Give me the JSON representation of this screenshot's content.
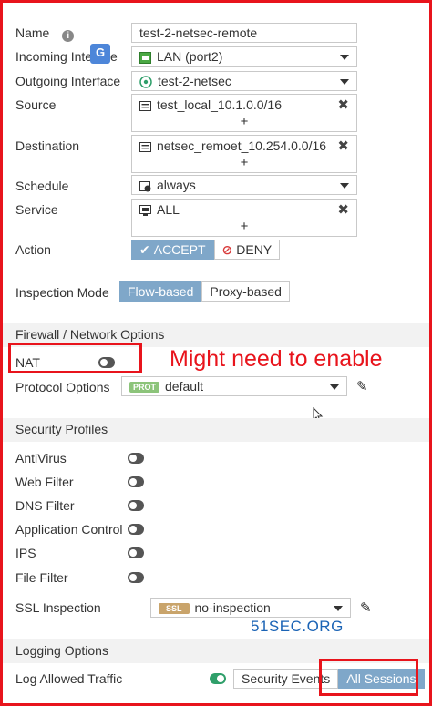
{
  "form": {
    "name_label": "Name",
    "name_value": "test-2-netsec-remote",
    "incoming_label": "Incoming Inte",
    "incoming_label_tail": "e",
    "incoming_value": "LAN (port2)",
    "outgoing_label": "Outgoing Interface",
    "outgoing_value": "test-2-netsec",
    "source_label": "Source",
    "source_value": "test_local_10.1.0.0/16",
    "destination_label": "Destination",
    "destination_value": "netsec_remoet_10.254.0.0/16",
    "schedule_label": "Schedule",
    "schedule_value": "always",
    "service_label": "Service",
    "service_value": "ALL",
    "action_label": "Action",
    "accept_label": "ACCEPT",
    "deny_label": "DENY",
    "plus": "+",
    "remove": "✖",
    "inspection_label": "Inspection Mode",
    "flow_label": "Flow-based",
    "proxy_label": "Proxy-based"
  },
  "firewall": {
    "section_title": "Firewall / Network Options",
    "nat_label": "NAT",
    "nat_enabled": false,
    "protocol_label": "Protocol Options",
    "protocol_tag": "PROT",
    "protocol_value": "default"
  },
  "annotation": {
    "text": "Might need to enable"
  },
  "profiles": {
    "section_title": "Security Profiles",
    "items": [
      {
        "label": "AntiVirus",
        "enabled": false
      },
      {
        "label": "Web Filter",
        "enabled": false
      },
      {
        "label": "DNS Filter",
        "enabled": false
      },
      {
        "label": "Application Control",
        "enabled": false
      },
      {
        "label": "IPS",
        "enabled": false
      },
      {
        "label": "File Filter",
        "enabled": false
      }
    ],
    "ssl_label": "SSL Inspection",
    "ssl_tag": "SSL",
    "ssl_value": "no-inspection"
  },
  "watermark": "51SEC.ORG",
  "logging": {
    "section_title": "Logging Options",
    "log_label": "Log Allowed Traffic",
    "log_enabled": true,
    "security_events_label": "Security Events",
    "all_sessions_label": "All Sessions"
  },
  "colors": {
    "accent": "#7fa7c9",
    "annotation_red": "#e8141c",
    "toggle_on": "#2f9f6a",
    "deny_red": "#d93a3a",
    "prot_tag": "#8cc47a",
    "ssl_tag": "#c9a46b"
  },
  "icons": {
    "info": "info-icon",
    "translate": "translate-icon",
    "lan_port": "network-port-icon",
    "tunnel": "vpn-tunnel-icon",
    "address": "address-object-icon",
    "schedule": "schedule-icon",
    "service": "service-icon",
    "accept": "checkmark-icon",
    "deny": "block-icon",
    "edit": "pencil-icon",
    "cursor": "mouse-cursor-icon"
  }
}
